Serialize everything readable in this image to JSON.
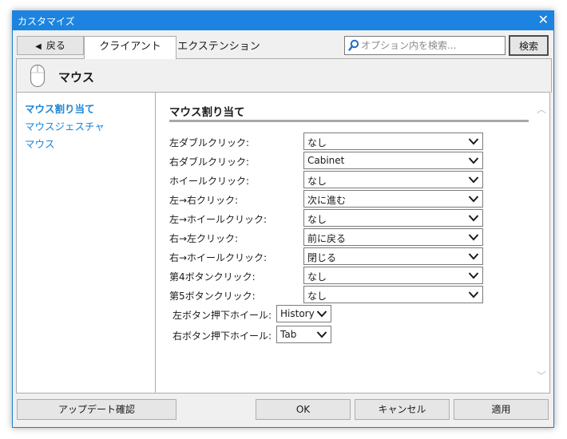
{
  "window": {
    "title": "カスタマイズ"
  },
  "toolbar": {
    "back_label": "戻る",
    "tabs": [
      {
        "label": "クライアント",
        "active": true
      },
      {
        "label": "エクステンション",
        "active": false
      }
    ],
    "search_placeholder": "オプション内を検索...",
    "search_button": "検索"
  },
  "header": {
    "title": "マウス",
    "icon": "mouse-icon"
  },
  "sidebar": {
    "items": [
      {
        "label": "マウス割り当て",
        "active": true
      },
      {
        "label": "マウスジェスチャ",
        "active": false
      },
      {
        "label": "マウス",
        "active": false
      }
    ]
  },
  "panel": {
    "title": "マウス割り当て",
    "rows": [
      {
        "label": "左ダブルクリック:",
        "value": "なし"
      },
      {
        "label": "右ダブルクリック:",
        "value": "Cabinet"
      },
      {
        "label": "ホイールクリック:",
        "value": "なし"
      },
      {
        "label": "左→右クリック:",
        "value": "次に進む"
      },
      {
        "label": "左→ホイールクリック:",
        "value": "なし"
      },
      {
        "label": "右→左クリック:",
        "value": "前に戻る"
      },
      {
        "label": "右→ホイールクリック:",
        "value": "閉じる"
      },
      {
        "label": "第4ボタンクリック:",
        "value": "なし"
      },
      {
        "label": "第5ボタンクリック:",
        "value": "なし"
      }
    ],
    "wheel_rows": [
      {
        "label": "左ボタン押下ホイール:",
        "value": "History"
      },
      {
        "label": "右ボタン押下ホイール:",
        "value": "Tab"
      }
    ]
  },
  "footer": {
    "update_label": "アップデート確認",
    "ok_label": "OK",
    "cancel_label": "キャンセル",
    "apply_label": "適用"
  },
  "colors": {
    "titlebar": "#1c84e0",
    "link": "#1e86d6"
  }
}
